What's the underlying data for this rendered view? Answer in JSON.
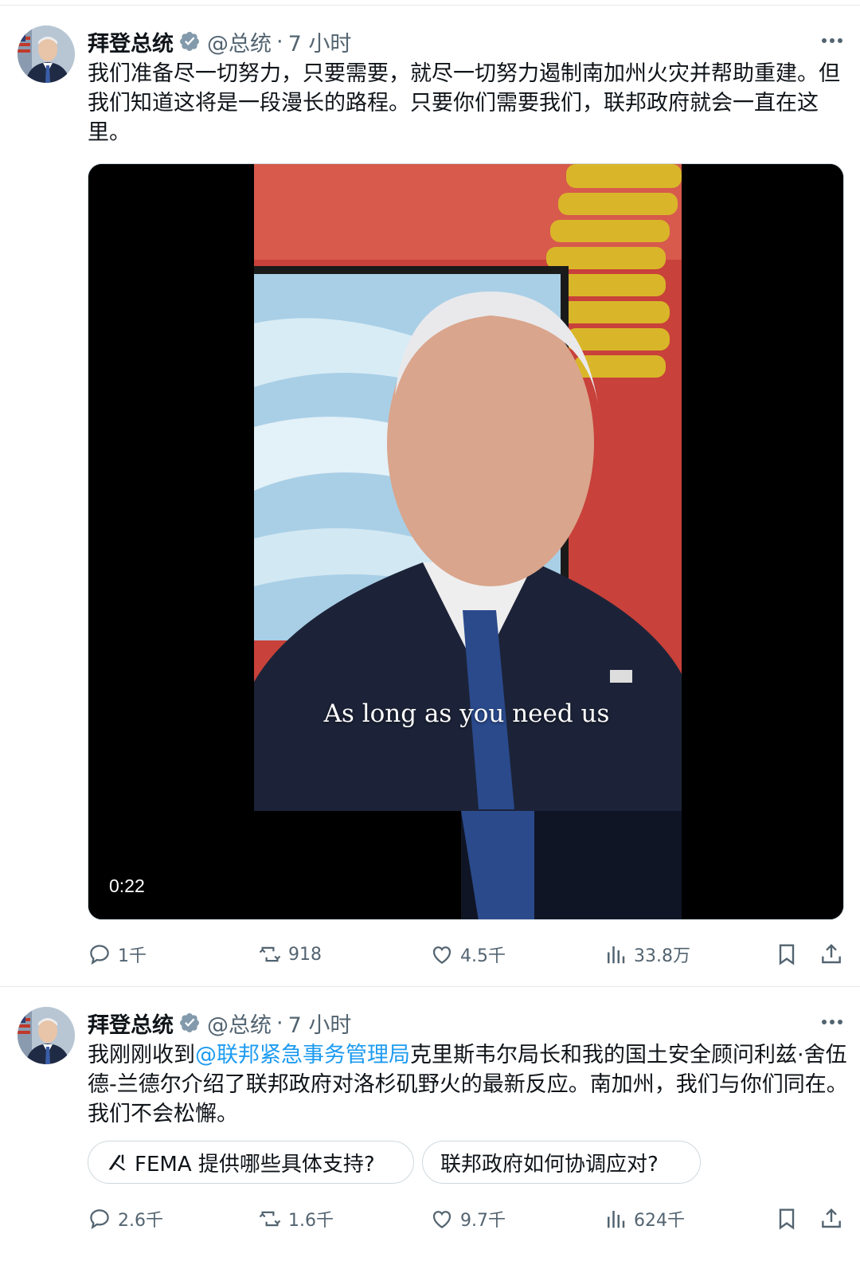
{
  "tweets": [
    {
      "author_name": "拜登总统",
      "handle": "@总统",
      "separator": "·",
      "time": "7 小时",
      "text": "我们准备尽一切努力，只要需要，就尽一切努力遏制南加州火灾并帮助重建。但我们知道这将是一段漫长的路程。只要你们需要我们，联邦政府就会一直在这里。",
      "video": {
        "caption": "As long as you need us",
        "duration": "0:22"
      },
      "stats": {
        "replies": "1千",
        "reposts": "918",
        "likes": "4.5千",
        "views": "33.8万"
      }
    },
    {
      "author_name": "拜登总统",
      "handle": "@总统",
      "separator": "·",
      "time": "7 小时",
      "text_before": "我刚刚收到",
      "mention": "@联邦紧急事务管理局",
      "text_after": "克里斯韦尔局长和我的国土安全顾问利兹·舍伍德-兰德尔介绍了联邦政府对洛杉矶野火的最新反应。南加州，我们与你们同在。我们不会松懈。",
      "suggestions": [
        "FEMA 提供哪些具体支持?",
        "联邦政府如何协调应对?"
      ],
      "stats": {
        "replies": "2.6千",
        "reposts": "1.6千",
        "likes": "9.7千",
        "views": "624千"
      }
    }
  ],
  "icons": {
    "verified": "verified-badge-icon",
    "more": "more-icon",
    "reply": "reply-icon",
    "repost": "repost-icon",
    "like": "like-icon",
    "views": "views-icon",
    "bookmark": "bookmark-icon",
    "share": "share-icon",
    "grok": "grok-icon"
  },
  "colors": {
    "link": "#1d9bf0",
    "secondary_text": "#536471",
    "verified": "#829aab"
  }
}
